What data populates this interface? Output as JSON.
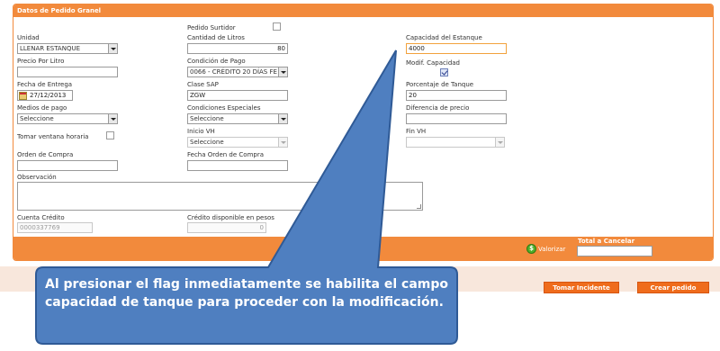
{
  "panel": {
    "title": "Datos de Pedido Granel"
  },
  "form": {
    "pedido_surtidor": {
      "label": "Pedido Surtidor",
      "checked": false
    },
    "unidad": {
      "label": "Unidad",
      "value": "LLENAR ESTANQUE"
    },
    "cantidad_litros": {
      "label": "Cantidad de Litros",
      "value": "80"
    },
    "capacidad_estanque": {
      "label": "Capacidad del Estanque",
      "value": "4000"
    },
    "precio_por_litro": {
      "label": "Precio Por Litro",
      "value": ""
    },
    "condicion_pago": {
      "label": "Condición de Pago",
      "value": "0066 - CRÉDITO 20 DÍAS FE"
    },
    "modif_capacidad": {
      "label": "Modif. Capacidad",
      "checked": true
    },
    "fecha_entrega": {
      "label": "Fecha de Entrega",
      "value": "27/12/2013"
    },
    "clase_sap": {
      "label": "Clase SAP",
      "value": "ZGW"
    },
    "porcentaje_tanque": {
      "label": "Porcentaje de Tanque",
      "value": "20"
    },
    "medios_pago": {
      "label": "Medios de pago",
      "value": "Seleccione"
    },
    "condiciones_especiales": {
      "label": "Condiciones Especiales",
      "value": "Seleccione"
    },
    "diferencia_precio": {
      "label": "Diferencia de precio",
      "value": ""
    },
    "tomar_ventana": {
      "label": "Tomar ventana horaria",
      "checked": false
    },
    "inicio_vh": {
      "label": "Inicio VH",
      "value": "Seleccione"
    },
    "fin_vh": {
      "label": "Fin VH",
      "value": ""
    },
    "orden_compra": {
      "label": "Orden de Compra",
      "value": ""
    },
    "fecha_orden_compra": {
      "label": "Fecha Orden de Compra",
      "value": ""
    },
    "observacion": {
      "label": "Observación",
      "value": ""
    },
    "cuenta_credito": {
      "label": "Cuenta Crédito",
      "value": "0000337769"
    },
    "credito_disponible": {
      "label": "Crédito disponible en pesos",
      "value": "0"
    }
  },
  "footer": {
    "valorizar_label": "Valorizar",
    "valorizar_icon_glyph": "$",
    "total_label": "Total a Cancelar",
    "total_value": ""
  },
  "actions": {
    "tomar_incidente": "Tomar Incidente",
    "crear_pedido": "Crear pedido"
  },
  "callout": {
    "text": "Al presionar el flag inmediatamente se habilita el campo capacidad de tanque para proceder con la modificación."
  },
  "colors": {
    "accent_orange": "#f28a3c",
    "button_orange": "#ef6c1c",
    "callout_blue": "#4f7fc0",
    "callout_border": "#2f5a96"
  }
}
